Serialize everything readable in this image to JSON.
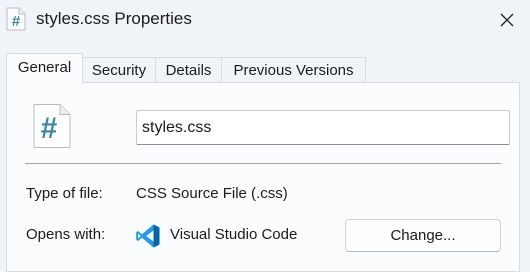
{
  "window": {
    "title": "styles.css Properties",
    "title_icon": "css-file-icon",
    "close_icon": "close-icon"
  },
  "tabs": [
    {
      "label": "General",
      "active": true
    },
    {
      "label": "Security",
      "active": false
    },
    {
      "label": "Details",
      "active": false
    },
    {
      "label": "Previous Versions",
      "active": false
    }
  ],
  "general": {
    "file_icon": "css-file-icon",
    "file_name": "styles.css",
    "type_label": "Type of file:",
    "type_value": "CSS Source File (.css)",
    "opens_label": "Opens with:",
    "opens_app_icon": "vscode-icon",
    "opens_value": "Visual Studio Code",
    "change_button": "Change..."
  },
  "colors": {
    "css_icon_hash": "#3a86a8",
    "vscode_blue": "#0065a9",
    "vscode_light": "#1f9cf0",
    "window_bg": "#f0f4f9",
    "panel_bg": "#fbfcfd"
  }
}
